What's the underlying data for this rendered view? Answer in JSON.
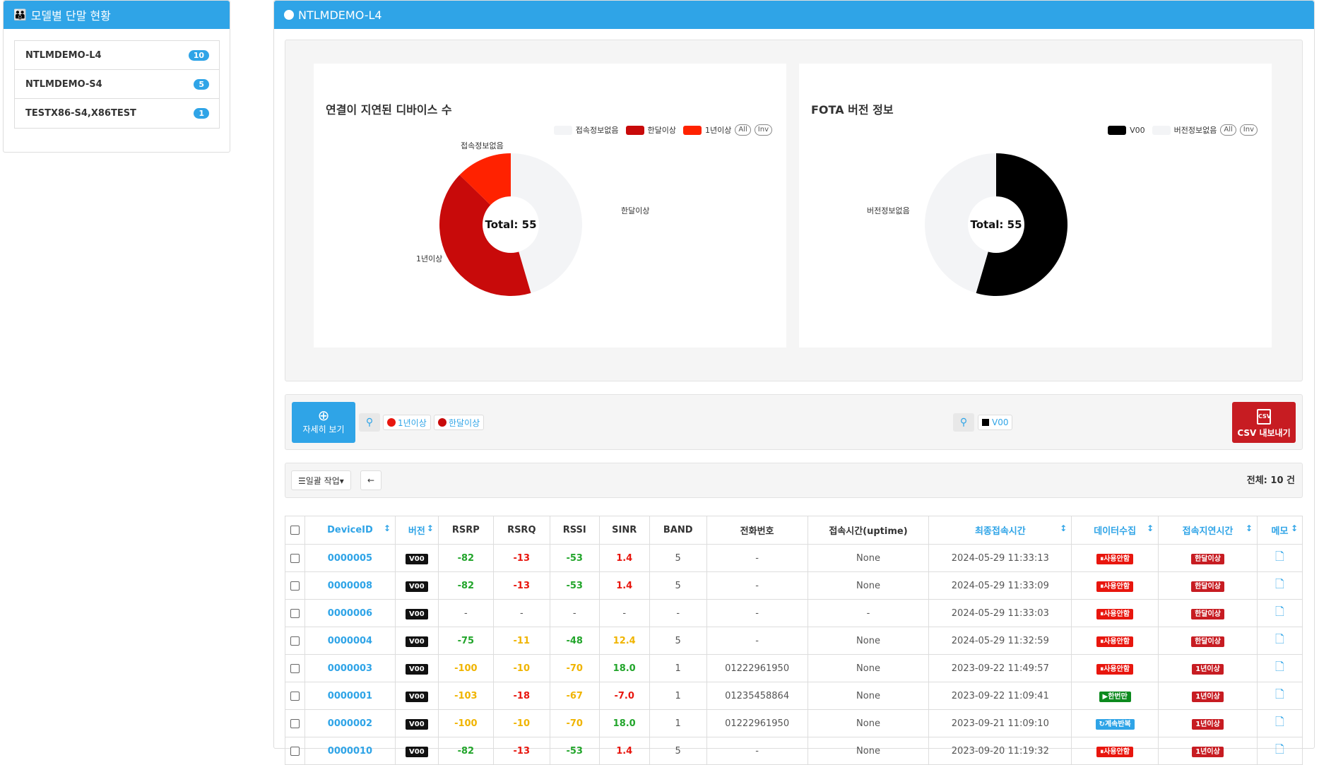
{
  "left_panel": {
    "title": "모델별 단말 현황",
    "items": [
      {
        "label": "NTLMDEMO-L4",
        "count": "10"
      },
      {
        "label": "NTLMDEMO-S4",
        "count": "5"
      },
      {
        "label": "TESTX86-S4,X86TEST",
        "count": "1"
      }
    ]
  },
  "right_panel": {
    "title": "NTLMDEMO-L4"
  },
  "colors": {
    "accent": "#2fa4e7",
    "danger": "#c71c22",
    "bright_red": "#ff2200",
    "dark_red": "#c80a0a",
    "light_gray": "#f3f4f6",
    "black": "#000000"
  },
  "chart_data": [
    {
      "type": "pie",
      "title": "연결이 지연된 디바이스 수",
      "center_label": "Total: 55",
      "legend": [
        "접속정보없음",
        "한달이상",
        "1년이상"
      ],
      "legend_pills": [
        "All",
        "Inv"
      ],
      "slices": [
        {
          "label": "접속정보없음",
          "value": 25,
          "color": "#f3f4f6"
        },
        {
          "label": "한달이상",
          "value": 23,
          "color": "#c80a0a"
        },
        {
          "label": "1년이상",
          "value": 7,
          "color": "#ff2200"
        }
      ]
    },
    {
      "type": "pie",
      "title": "FOTA 버전 정보",
      "center_label": "Total: 55",
      "legend": [
        "V00",
        "버전정보없음"
      ],
      "legend_pills": [
        "All",
        "Inv"
      ],
      "slices": [
        {
          "label": "V00",
          "value": 30,
          "color": "#000000"
        },
        {
          "label": "버전정보없음",
          "value": 25,
          "color": "#f3f4f6"
        }
      ]
    }
  ],
  "toolbar": {
    "detail_label": "자세히 보기",
    "filters": [
      "1년이상",
      "한달이상"
    ],
    "version_filter": "V00",
    "csv_label": "CSV 내보내기",
    "csv_icon": "CSV"
  },
  "actions": {
    "bulk_label": "☰일괄 작업▾",
    "back_icon": "←",
    "total": "전체: 10 건"
  },
  "table": {
    "headers": [
      "DeviceID",
      "버전",
      "RSRP",
      "RSRQ",
      "RSSI",
      "SINR",
      "BAND",
      "전화번호",
      "접속시간(uptime)",
      "최종접속시간",
      "데이터수집",
      "접속지연시간",
      "메모"
    ],
    "rows": [
      {
        "id": "0000005",
        "ver": "V00",
        "rsrp": "-82",
        "rsrq": "-13",
        "rssi": "-53",
        "sinr": "1.4",
        "band": "5",
        "phone": "-",
        "uptime": "None",
        "last": "2024-05-29 11:33:13",
        "collect": "⏸사용안함",
        "delay": "한달이상"
      },
      {
        "id": "0000008",
        "ver": "V00",
        "rsrp": "-82",
        "rsrq": "-13",
        "rssi": "-53",
        "sinr": "1.4",
        "band": "5",
        "phone": "-",
        "uptime": "None",
        "last": "2024-05-29 11:33:09",
        "collect": "⏸사용안함",
        "delay": "한달이상"
      },
      {
        "id": "0000006",
        "ver": "V00",
        "rsrp": "-",
        "rsrq": "-",
        "rssi": "-",
        "sinr": "-",
        "band": "-",
        "phone": "-",
        "uptime": "-",
        "last": "2024-05-29 11:33:03",
        "collect": "⏸사용안함",
        "delay": "한달이상"
      },
      {
        "id": "0000004",
        "ver": "V00",
        "rsrp": "-75",
        "rsrq": "-11",
        "rssi": "-48",
        "sinr": "12.4",
        "band": "5",
        "phone": "-",
        "uptime": "None",
        "last": "2024-05-29 11:32:59",
        "collect": "⏸사용안함",
        "delay": "한달이상"
      },
      {
        "id": "0000003",
        "ver": "V00",
        "rsrp": "-100",
        "rsrq": "-10",
        "rssi": "-70",
        "sinr": "18.0",
        "band": "1",
        "phone": "01222961950",
        "uptime": "None",
        "last": "2023-09-22 11:49:57",
        "collect": "⏸사용안함",
        "delay": "1년이상"
      },
      {
        "id": "0000001",
        "ver": "V00",
        "rsrp": "-103",
        "rsrq": "-18",
        "rssi": "-67",
        "sinr": "-7.0",
        "band": "1",
        "phone": "01235458864",
        "uptime": "None",
        "last": "2023-09-22 11:09:41",
        "collect": "▶한번만",
        "delay": "1년이상"
      },
      {
        "id": "0000002",
        "ver": "V00",
        "rsrp": "-100",
        "rsrq": "-10",
        "rssi": "-70",
        "sinr": "18.0",
        "band": "1",
        "phone": "01222961950",
        "uptime": "None",
        "last": "2023-09-21 11:09:10",
        "collect": "↻계속반복",
        "delay": "1년이상"
      },
      {
        "id": "0000010",
        "ver": "V00",
        "rsrp": "-82",
        "rsrq": "-13",
        "rssi": "-53",
        "sinr": "1.4",
        "band": "5",
        "phone": "-",
        "uptime": "None",
        "last": "2023-09-20 11:19:32",
        "collect": "⏸사용안함",
        "delay": "1년이상"
      }
    ]
  }
}
